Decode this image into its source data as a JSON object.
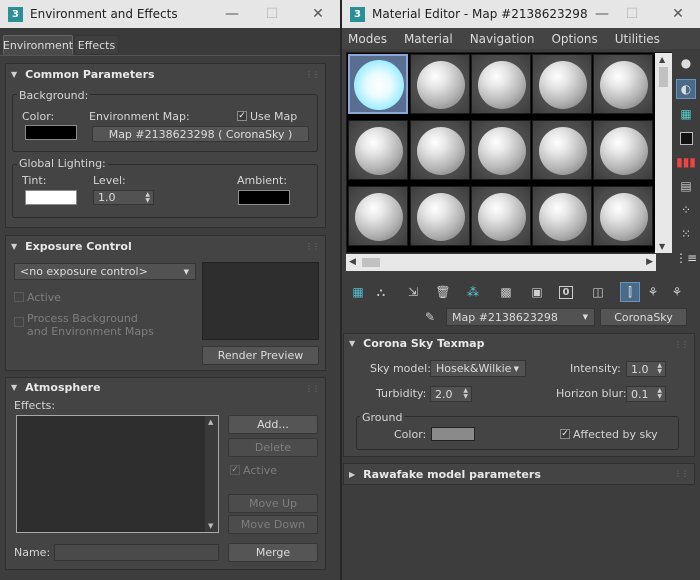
{
  "env_window": {
    "title": "Environment and Effects",
    "tabs": [
      "Environment",
      "Effects"
    ],
    "common": {
      "title": "Common Parameters",
      "background_label": "Background:",
      "color_label": "Color:",
      "env_map_label": "Environment Map:",
      "use_map_label": "Use Map",
      "map_button": "Map #2138623298  ( CoronaSky )",
      "global_lighting_label": "Global Lighting:",
      "tint_label": "Tint:",
      "level_label": "Level:",
      "level_value": "1.0",
      "ambient_label": "Ambient:",
      "bg_color": "#000000",
      "tint_color": "#ffffff",
      "ambient_color": "#000000"
    },
    "exposure": {
      "title": "Exposure Control",
      "dropdown": "<no exposure control>",
      "active_label": "Active",
      "process_label_1": "Process Background",
      "process_label_2": "and Environment Maps",
      "render_preview": "Render Preview"
    },
    "atmosphere": {
      "title": "Atmosphere",
      "effects_label": "Effects:",
      "add": "Add...",
      "delete": "Delete",
      "active": "Active",
      "move_up": "Move Up",
      "move_down": "Move Down",
      "name_label": "Name:",
      "merge": "Merge"
    }
  },
  "mat_window": {
    "title": "Material Editor - Map #2138623298",
    "menu": [
      "Modes",
      "Material",
      "Navigation",
      "Options",
      "Utilities"
    ],
    "map_dropdown": "Map #2138623298",
    "map_type_button": "CoronaSky",
    "sky": {
      "title": "Corona Sky Texmap",
      "sky_model_label": "Sky model:",
      "sky_model_value": "Hosek&Wilkie",
      "intensity_label": "Intensity:",
      "intensity_value": "1.0",
      "turbidity_label": "Turbidity:",
      "turbidity_value": "2.0",
      "horizon_blur_label": "Horizon blur:",
      "horizon_blur_value": "0.1",
      "ground_label": "Ground",
      "color_label": "Color:",
      "affected_label": "Affected by sky",
      "ground_color": "#8a8a8a"
    },
    "rawafake": {
      "title": "Rawafake model parameters"
    }
  }
}
